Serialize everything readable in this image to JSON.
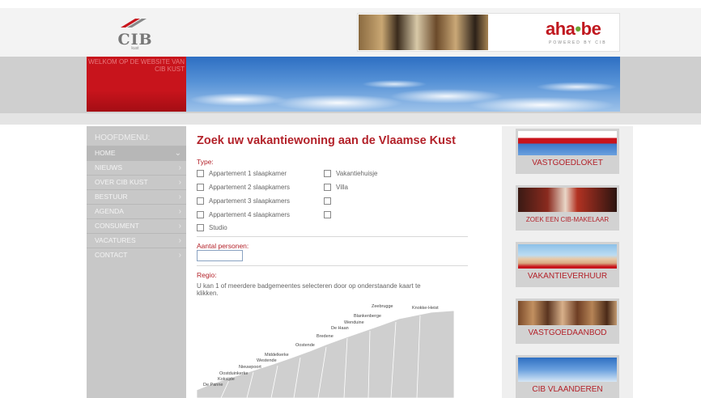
{
  "header": {
    "logo_text": "CIB",
    "logo_sub": "kust",
    "ad_brand_left": "aha",
    "ad_brand_dot": "•",
    "ad_brand_right": "be",
    "ad_powered": "POWERED BY CIB"
  },
  "banner": {
    "welcome": "WELKOM OP DE WEBSITE VAN CIB KUST"
  },
  "menu": {
    "title": "HOOFDMENU:",
    "items": [
      {
        "label": "HOME"
      },
      {
        "label": "NIEUWS"
      },
      {
        "label": "OVER CIB KUST"
      },
      {
        "label": "BESTUUR"
      },
      {
        "label": "AGENDA"
      },
      {
        "label": "CONSUMENT"
      },
      {
        "label": "VACATURES"
      },
      {
        "label": "CONTACT"
      }
    ],
    "chevron": "›",
    "active_chevron": "⌄"
  },
  "form": {
    "title": "Zoek uw vakantiewoning aan de Vlaamse Kust",
    "type_label": "Type:",
    "types_left": [
      "Appartement 1 slaapkamer",
      "Appartement 2 slaapkamers",
      "Appartement 3 slaapkamers",
      "Appartement 4 slaapkamers",
      "Studio"
    ],
    "types_right": [
      "Vakantiehuisje",
      "Villa",
      "",
      ""
    ],
    "persons_label": "Aantal personen:",
    "persons_value": "",
    "region_label": "Regio:",
    "region_help": "U kan 1 of meerdere badgemeentes selecteren door op onderstaande kaart te klikken.",
    "map_places": [
      "Zeebrugge",
      "Knokke-Heist",
      "Blankenberge",
      "Wenduine",
      "De Haan",
      "Bredene",
      "Oostende",
      "Middelkerke",
      "Westende",
      "Nieuwpoort",
      "Oostduinkerke",
      "Koksijde",
      "De Panne"
    ]
  },
  "right_cards": [
    {
      "label": "VASTGOEDLOKET"
    },
    {
      "label": "ZOEK EEN CIB-MAKELAAR"
    },
    {
      "label": "VAKANTIEVERHUUR"
    },
    {
      "label": "VASTGOEDAANBOD"
    },
    {
      "label": "CIB VLAANDEREN"
    }
  ],
  "colors": {
    "accent": "#b3222a",
    "menu_bg": "#c8c8c8",
    "banner_red": "#c8141c"
  }
}
